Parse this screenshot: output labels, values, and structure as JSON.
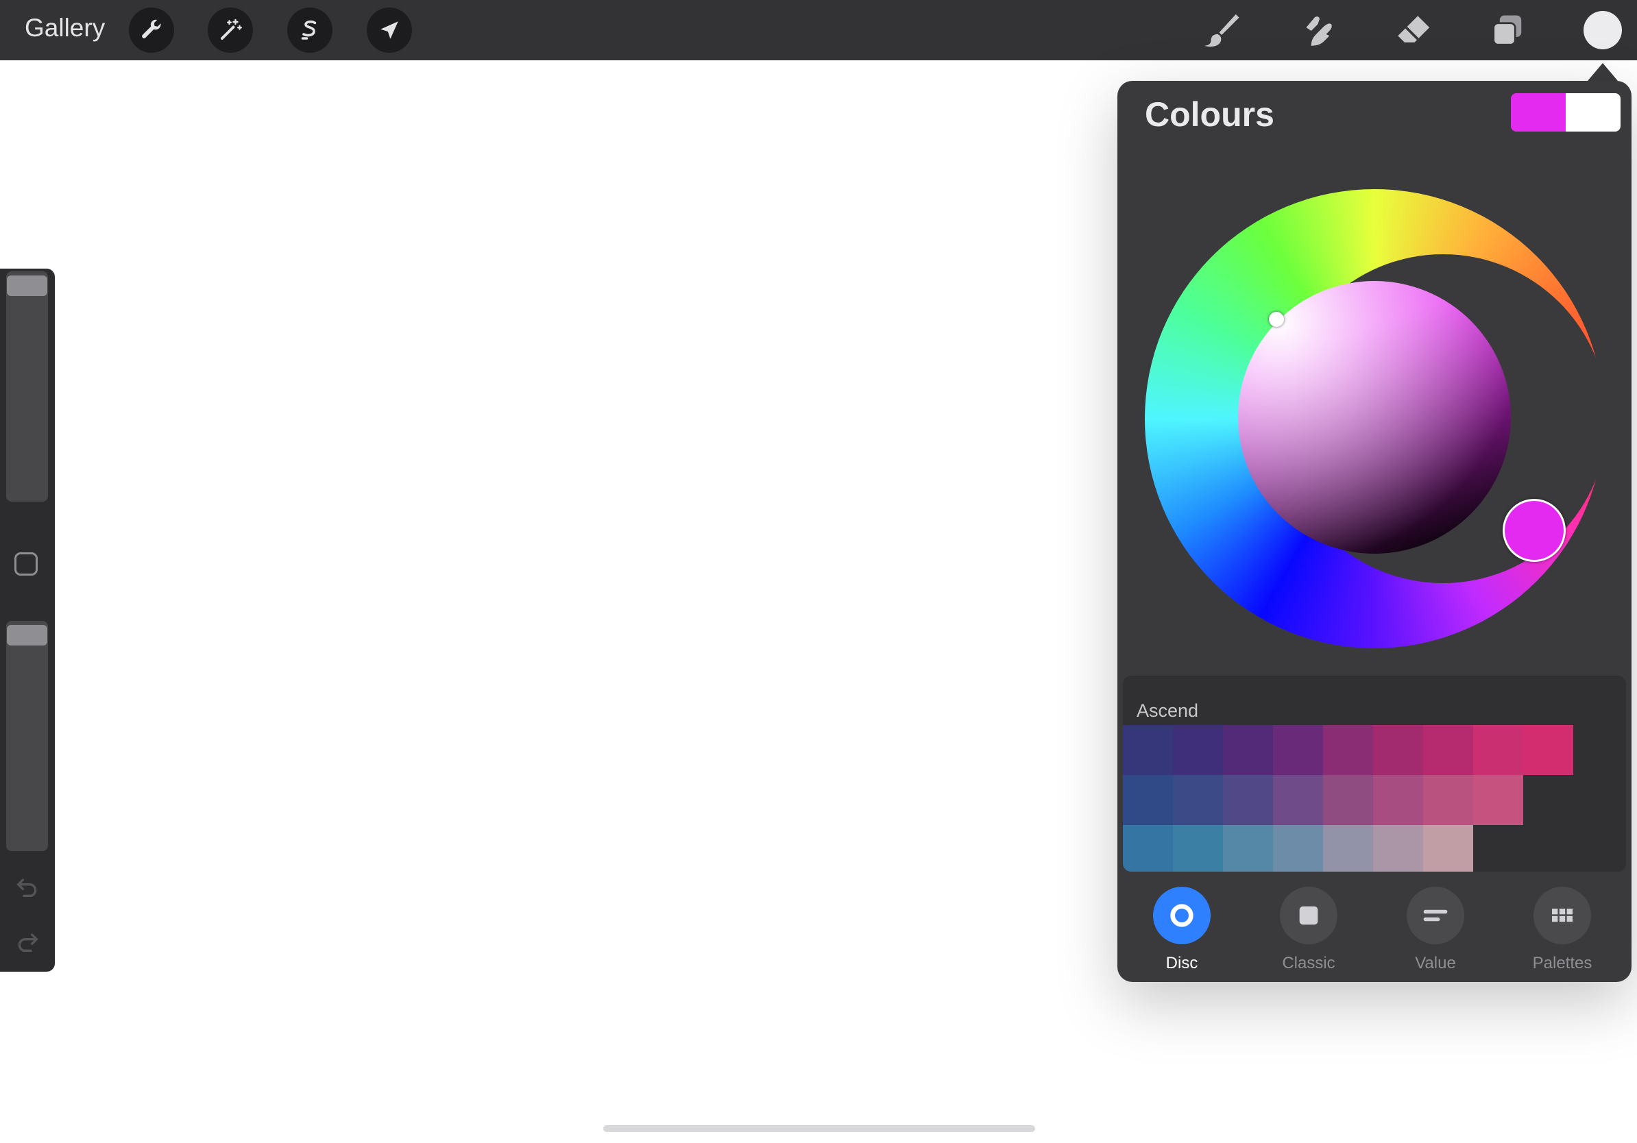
{
  "topbar": {
    "gallery_label": "Gallery",
    "left_tools": [
      {
        "name": "actions",
        "icon": "wrench-icon"
      },
      {
        "name": "adjustments",
        "icon": "magic-wand-icon"
      },
      {
        "name": "selection",
        "icon": "selection-s-icon"
      },
      {
        "name": "transform",
        "icon": "arrow-cursor-icon"
      }
    ],
    "right_tools": [
      {
        "name": "brush",
        "icon": "brush-icon"
      },
      {
        "name": "smudge",
        "icon": "smudge-finger-icon"
      },
      {
        "name": "eraser",
        "icon": "eraser-icon"
      },
      {
        "name": "layers",
        "icon": "layers-icon"
      },
      {
        "name": "colours",
        "icon": "colour-dot-icon",
        "color": "#ececee"
      }
    ]
  },
  "colours_panel": {
    "title": "Colours",
    "primary_color": "#e429f0",
    "secondary_color": "#ffffff",
    "selected_hue_color": "#e429f0",
    "palette": {
      "name": "Ascend",
      "rows": [
        [
          "#36367a",
          "#3f2e7a",
          "#532a78",
          "#6a2a7a",
          "#8b2d75",
          "#a22b6f",
          "#b62b70",
          "#c92f71",
          "#d42d6f",
          null
        ],
        [
          "#2f4a86",
          "#3c4a88",
          "#514887",
          "#6f4b8a",
          "#8e4c80",
          "#a84d81",
          "#b9527f",
          "#c6537f",
          null,
          null
        ],
        [
          "#3475a3",
          "#3b7fa5",
          "#5587a7",
          "#6c8ca7",
          "#9293a8",
          "#aa96a6",
          "#c19ea5",
          null,
          null,
          null
        ]
      ]
    },
    "modes": [
      {
        "label": "Disc",
        "icon": "disc-ring-icon",
        "active": true
      },
      {
        "label": "Classic",
        "icon": "classic-square-icon",
        "active": false
      },
      {
        "label": "Value",
        "icon": "value-bars-icon",
        "active": false
      },
      {
        "label": "Palettes",
        "icon": "palettes-grid-icon",
        "active": false
      }
    ]
  },
  "sidebar": {
    "brush_size_icon": "slider-thumb",
    "modify_icon": "square-outline-icon",
    "undo_icon": "undo-arrow-icon",
    "redo_icon": "redo-arrow-icon"
  }
}
